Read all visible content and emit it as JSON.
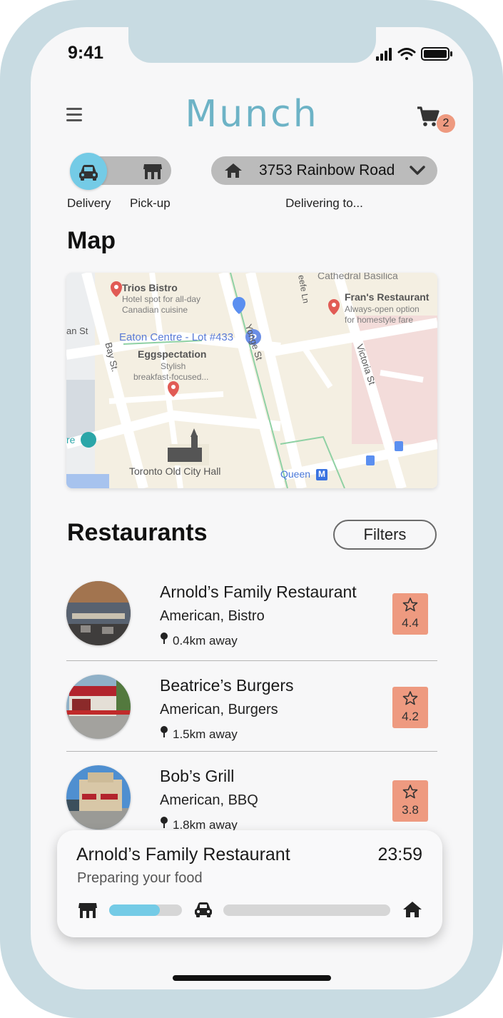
{
  "status_bar": {
    "time": "9:41"
  },
  "header": {
    "title": "Munch",
    "cart_count": "2"
  },
  "mode": {
    "delivery_label": "Delivery",
    "pickup_label": "Pick-up",
    "selected": "Delivery"
  },
  "address": {
    "value": "3753 Rainbow Road",
    "caption": "Delivering to..."
  },
  "map_section": {
    "title": "Map",
    "labels": {
      "basilica": "Cathedral Basilica",
      "trios_name": "Trios Bistro",
      "trios_desc1": "Hotel spot for all-day",
      "trios_desc2": "Canadian cuisine",
      "eaton": "Eaton Centre - Lot #433",
      "eggs_name": "Eggspectation",
      "eggs_desc1": "Stylish",
      "eggs_desc2": "breakfast-focused...",
      "frans_name": "Fran's Restaurant",
      "frans_desc1": "Always-open option",
      "frans_desc2": "for homestyle fare",
      "city_hall": "Toronto Old City Hall",
      "queen": "Queen",
      "metro": "M",
      "yonge": "Yonge St",
      "victoria": "Victoria St",
      "bay": "Bay St.",
      "an_st": "an St",
      "keefe": "eefe Ln",
      "re": "re"
    }
  },
  "restaurants_section": {
    "title": "Restaurants",
    "filters_label": "Filters",
    "items": [
      {
        "name": "Arnold’s Family Restaurant",
        "cuisine": "American, Bistro",
        "distance": "0.4km away",
        "rating": "4.4"
      },
      {
        "name": "Beatrice’s Burgers",
        "cuisine": "American, Burgers",
        "distance": "1.5km away",
        "rating": "4.2"
      },
      {
        "name": "Bob’s Grill",
        "cuisine": "American, BBQ",
        "distance": "1.8km away",
        "rating": "3.8"
      }
    ]
  },
  "order_tracker": {
    "restaurant": "Arnold’s Family Restaurant",
    "timer": "23:59",
    "status": "Preparing your food",
    "progress_first_leg": 0.7,
    "progress_second_leg": 0.0
  },
  "colors": {
    "accent": "#74cbe6",
    "title": "#6db3c6",
    "rating_bg": "#ee9a80",
    "frame": "#c8dbe2"
  }
}
